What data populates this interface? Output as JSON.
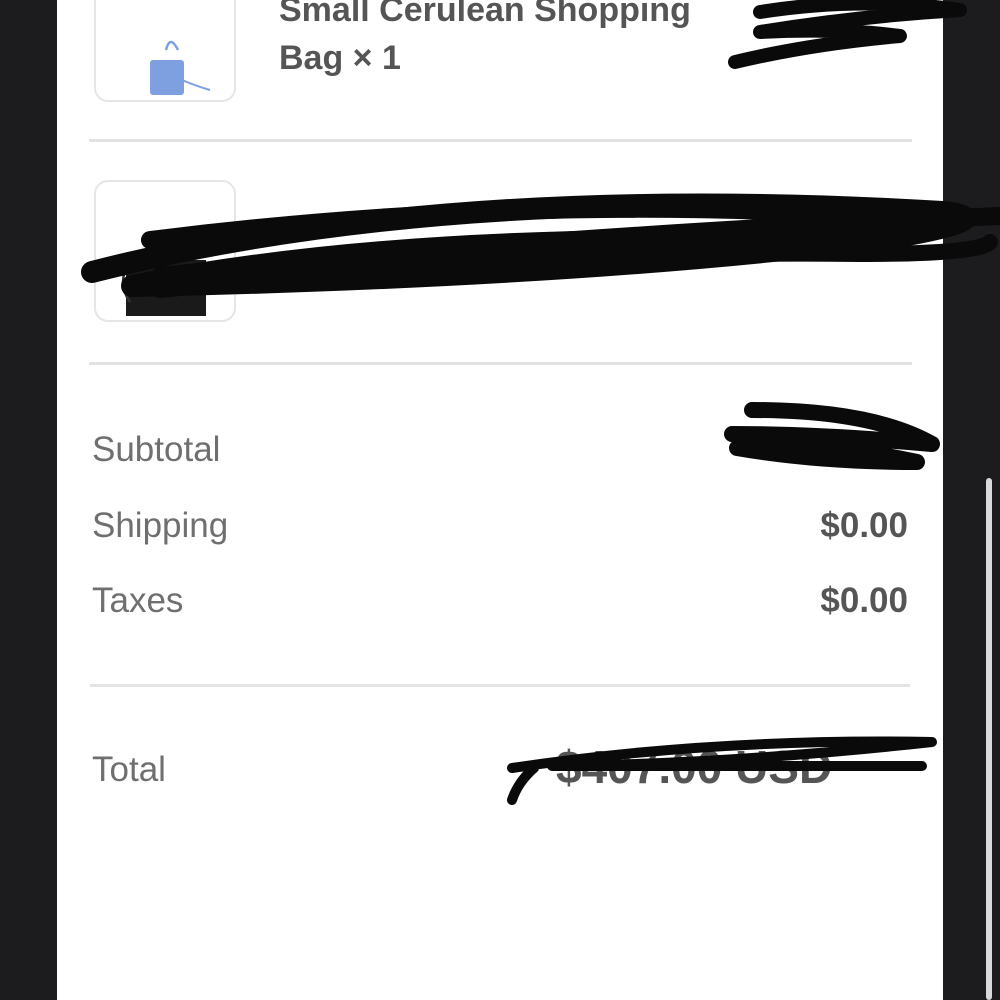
{
  "items": [
    {
      "title_line1": "Small Cerulean Shopping",
      "title_line2": "Bag × 1",
      "price": "$—"
    },
    {
      "title_line1": "",
      "title_line2": "",
      "price": ""
    }
  ],
  "summary": {
    "subtotal_label": "Subtotal",
    "subtotal_value": "",
    "shipping_label": "Shipping",
    "shipping_value": "$0.00",
    "taxes_label": "Taxes",
    "taxes_value": "$0.00",
    "total_label": "Total",
    "total_value": "$407.00 USD"
  },
  "colors": {
    "bag_blue": "#7ea0e0",
    "redaction": "#0a0a0a",
    "divider": "#e3e3e6"
  }
}
